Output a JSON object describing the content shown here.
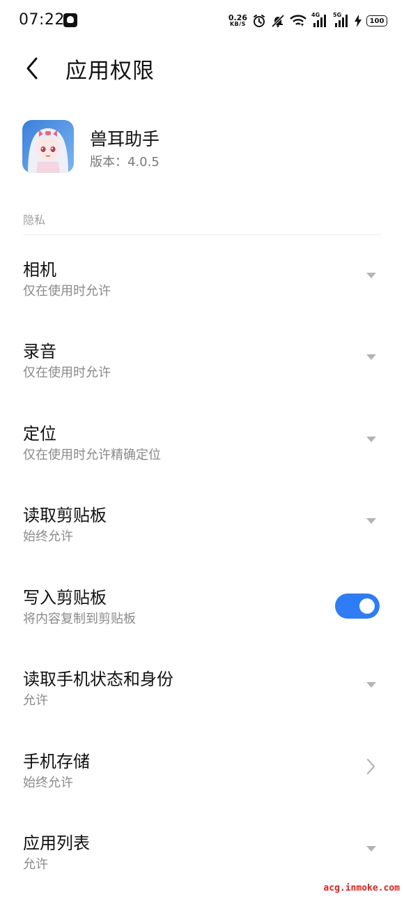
{
  "status_bar": {
    "time": "07:22",
    "net_speed_value": "0.26",
    "net_speed_unit": "KB/S",
    "signal_1_tag": "4G",
    "signal_2_tag": "5G",
    "battery": "100",
    "icons": [
      "notification-icon",
      "alarm-icon",
      "muted-bell-icon",
      "wifi-icon",
      "signal-icon",
      "signal-icon",
      "charging-icon",
      "battery-icon"
    ]
  },
  "header": {
    "title": "应用权限"
  },
  "app": {
    "name": "兽耳助手",
    "version": "版本：4.0.5"
  },
  "section": {
    "label": "隐私"
  },
  "permissions": [
    {
      "title": "相机",
      "subtitle": "仅在使用时允许",
      "control": "dropdown"
    },
    {
      "title": "录音",
      "subtitle": "仅在使用时允许",
      "control": "dropdown"
    },
    {
      "title": "定位",
      "subtitle": "仅在使用时允许精确定位",
      "control": "dropdown"
    },
    {
      "title": "读取剪贴板",
      "subtitle": "始终允许",
      "control": "dropdown"
    },
    {
      "title": "写入剪贴板",
      "subtitle": "将内容复制到剪贴板",
      "control": "toggle",
      "enabled": true
    },
    {
      "title": "读取手机状态和身份",
      "subtitle": "允许",
      "control": "dropdown"
    },
    {
      "title": "手机存储",
      "subtitle": "始终允许",
      "control": "chevron"
    },
    {
      "title": "应用列表",
      "subtitle": "允许",
      "control": "dropdown"
    }
  ],
  "watermark": "acg.inmoke.com",
  "colors": {
    "accent": "#2e7cf6",
    "secondary_text": "#8a8a8a",
    "watermark": "#e0201c"
  }
}
